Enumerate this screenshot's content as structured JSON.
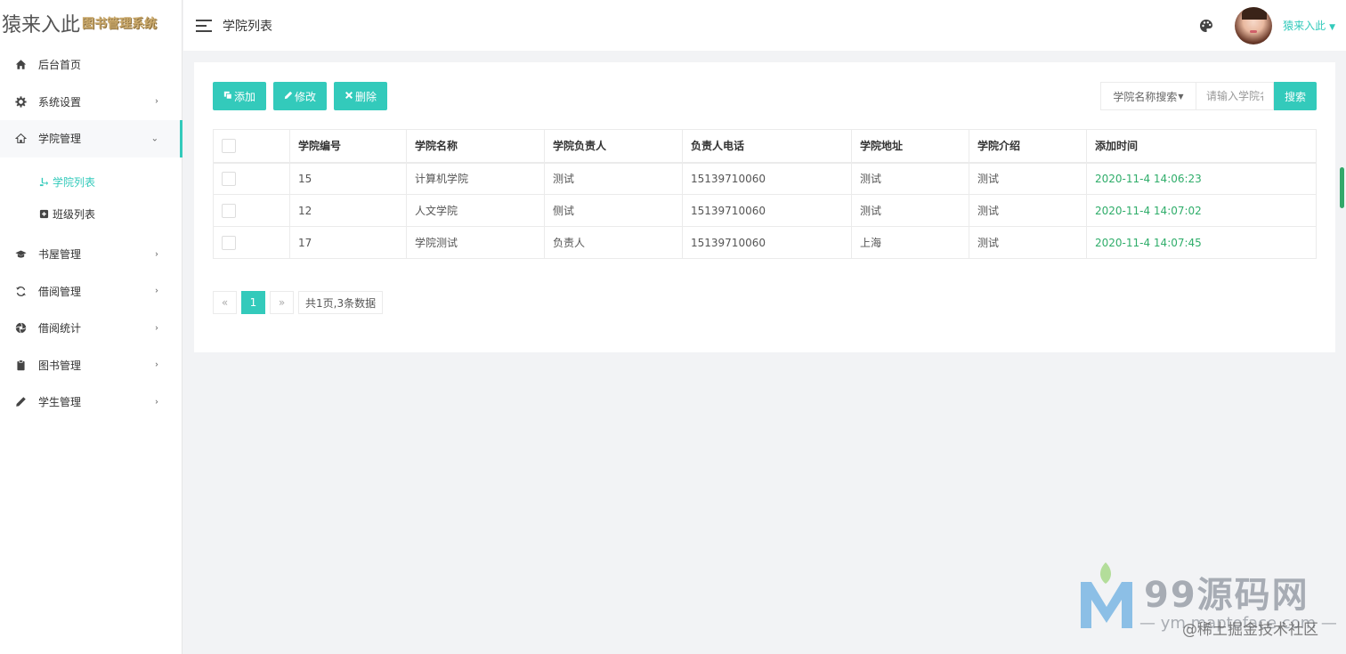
{
  "app": {
    "logo_main": "猿来入此",
    "logo_sub": "图书管理系统"
  },
  "header": {
    "page_title": "学院列表",
    "username": "猿来入此"
  },
  "sidebar": {
    "items": [
      {
        "label": "后台首页",
        "icon": "home-icon"
      },
      {
        "label": "系统设置",
        "icon": "gear-icon"
      },
      {
        "label": "学院管理",
        "icon": "home-outline-icon"
      },
      {
        "label": "书屋管理",
        "icon": "graduation-cap-icon"
      },
      {
        "label": "借阅管理",
        "icon": "refresh-icon"
      },
      {
        "label": "借阅统计",
        "icon": "aperture-icon"
      },
      {
        "label": "图书管理",
        "icon": "clipboard-icon"
      },
      {
        "label": "学生管理",
        "icon": "pencil-icon"
      }
    ],
    "subitems": [
      {
        "label": "学院列表",
        "icon": "fork-icon"
      },
      {
        "label": "班级列表",
        "icon": "plus-square-icon"
      }
    ]
  },
  "toolbar": {
    "add_label": "添加",
    "edit_label": "修改",
    "delete_label": "删除"
  },
  "search": {
    "select_label": "学院名称搜索",
    "placeholder": "请输入学院名称",
    "button_label": "搜索"
  },
  "table": {
    "headers": [
      "学院编号",
      "学院名称",
      "学院负责人",
      "负责人电话",
      "学院地址",
      "学院介绍",
      "添加时间"
    ],
    "rows": [
      [
        "15",
        "计算机学院",
        "测试",
        "15139710060",
        "测试",
        "测试",
        "2020-11-4 14:06:23"
      ],
      [
        "12",
        "人文学院",
        "侧试",
        "15139710060",
        "测试",
        "测试",
        "2020-11-4 14:07:02"
      ],
      [
        "17",
        "学院测试",
        "负责人",
        "15139710060",
        "上海",
        "测试",
        "2020-11-4 14:07:45"
      ]
    ]
  },
  "pagination": {
    "prev": "«",
    "current": "1",
    "next": "»",
    "info": "共1页,3条数据"
  },
  "watermark": {
    "title": "99源码网",
    "subtitle": "— ym.maptoface.com —",
    "community": "@稀土掘金技术社区"
  },
  "colors": {
    "accent": "#33cabb",
    "time_text": "#2fad6a"
  }
}
